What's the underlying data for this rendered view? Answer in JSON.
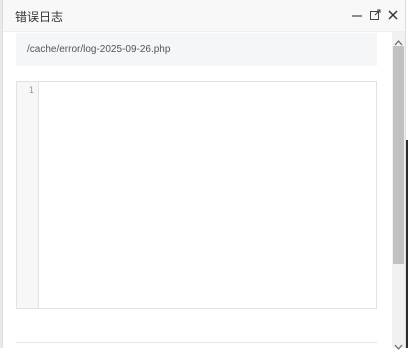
{
  "dialog": {
    "title": "错误日志",
    "file_path": "/cache/error/log-2025-09-26.php"
  },
  "editor": {
    "line_numbers": [
      "1"
    ],
    "content": ""
  },
  "window_controls": {
    "minimize_icon": "minimize-icon",
    "maximize_icon": "maximize-icon",
    "close_icon": "close-icon"
  },
  "colors": {
    "titlebar_bg": "#f8f8f8",
    "path_bg": "#f5f6f7",
    "gutter_bg": "#f7f7f7",
    "border": "#e2e2e2",
    "scroll_thumb": "#c1c1c1"
  }
}
